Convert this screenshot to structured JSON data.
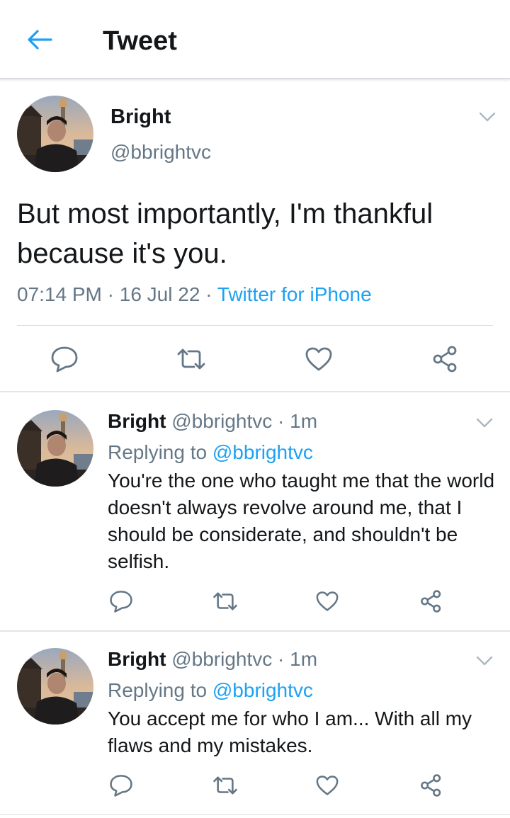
{
  "header": {
    "title": "Tweet"
  },
  "main_tweet": {
    "name": "Bright",
    "handle": "@bbrightvc",
    "text": "But most importantly, I'm thankful because it's you.",
    "time": "07:14 PM",
    "date": "16 Jul 22",
    "source": "Twitter for iPhone",
    "separator": " · "
  },
  "replies": [
    {
      "name": "Bright",
      "handle": "@bbrightvc",
      "dot": " · ",
      "time": "1m",
      "replying_prefix": "Replying to ",
      "replying_to": "@bbrightvc",
      "text": "You're the one who taught me that the world doesn't always revolve around me, that I should be considerate, and shouldn't be selfish."
    },
    {
      "name": "Bright",
      "handle": "@bbrightvc",
      "dot": " · ",
      "time": "1m",
      "replying_prefix": "Replying to ",
      "replying_to": "@bbrightvc",
      "text": "You accept me for who I am... With all my flaws and my mistakes."
    }
  ],
  "icons": {
    "back": "arrow-left-icon",
    "more": "chevron-down-icon",
    "reply": "speech-bubble-icon",
    "retweet": "retweet-icon",
    "like": "heart-icon",
    "share": "share-icon"
  },
  "colors": {
    "accent": "#1da1f2",
    "text": "#14171a",
    "muted": "#657786",
    "icon": "#657786",
    "divider": "#e1e6ea"
  }
}
